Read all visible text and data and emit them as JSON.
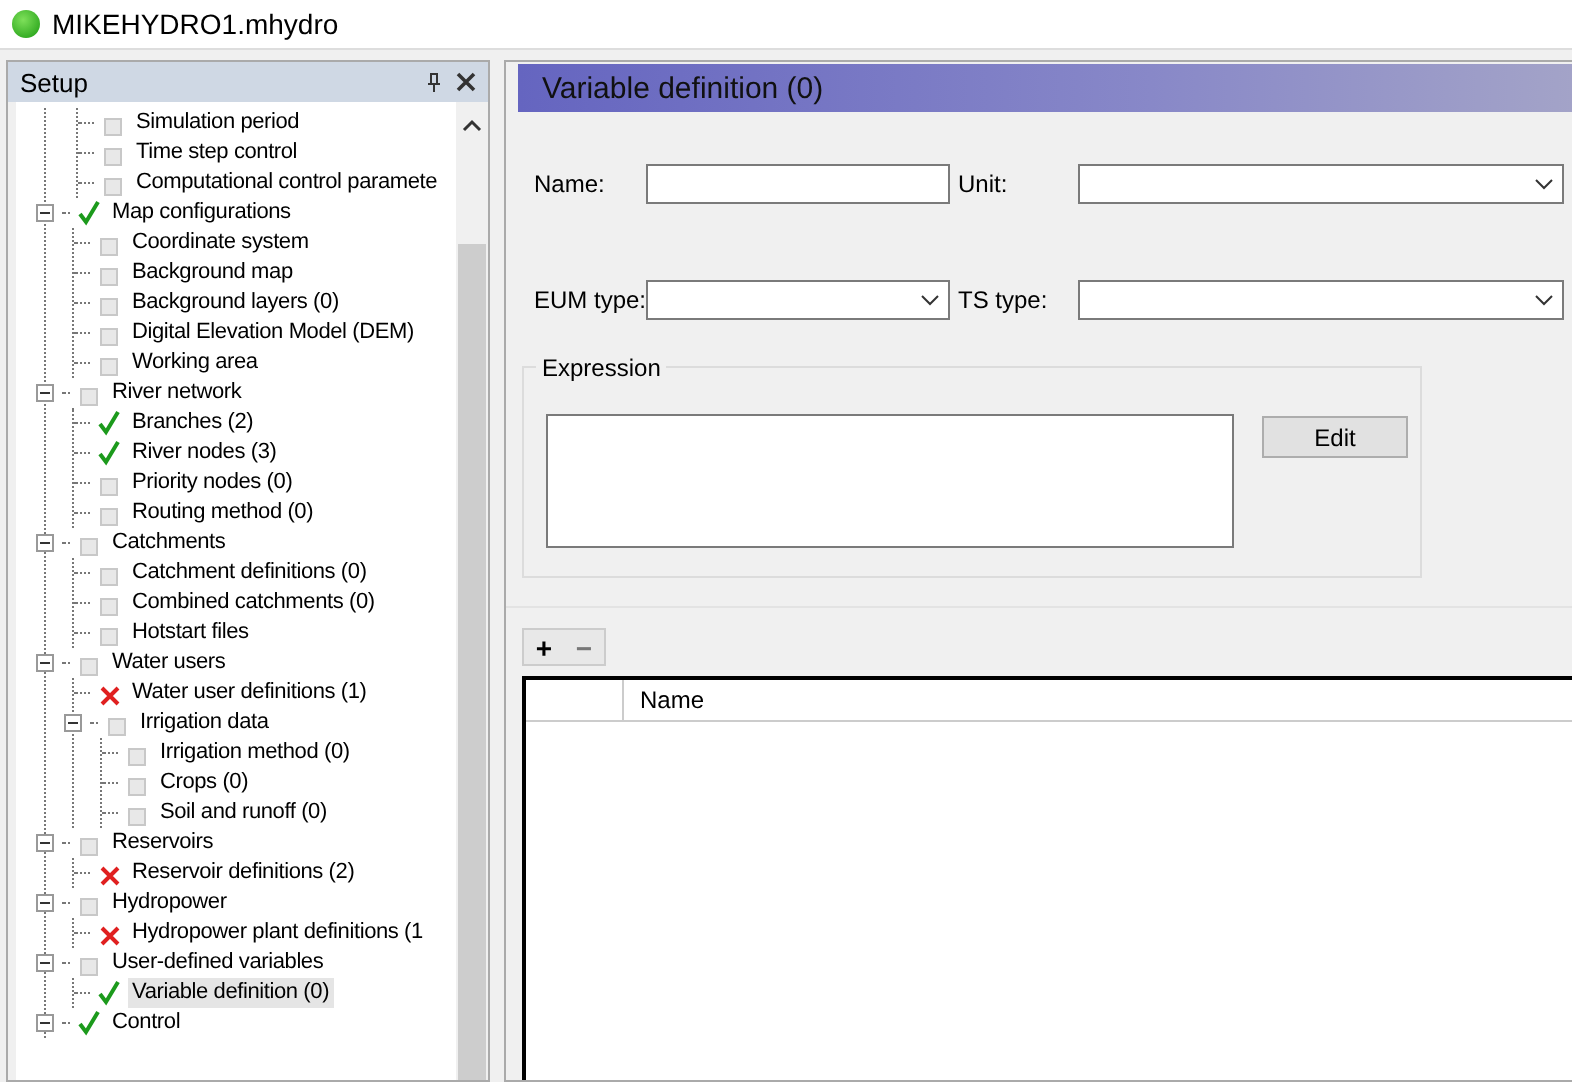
{
  "window": {
    "title": "MIKEHYDRO1.mhydro"
  },
  "setup_panel": {
    "title": "Setup",
    "tree": [
      {
        "children": [
          {
            "label": "Simulation period",
            "checked": false,
            "error": false,
            "selected": false
          },
          {
            "label": "Time step control",
            "checked": false,
            "error": false,
            "selected": false
          },
          {
            "label": "Computational control paramete",
            "checked": false,
            "error": false,
            "selected": false
          }
        ]
      },
      {
        "label": "Map configurations",
        "checked": true,
        "error": false,
        "expanded": true,
        "selected": false,
        "children": [
          {
            "label": "Coordinate system",
            "checked": false,
            "error": false,
            "selected": false
          },
          {
            "label": "Background map",
            "checked": false,
            "error": false,
            "selected": false
          },
          {
            "label": "Background layers (0)",
            "checked": false,
            "error": false,
            "selected": false
          },
          {
            "label": "Digital Elevation Model (DEM)",
            "checked": false,
            "error": false,
            "selected": false
          },
          {
            "label": "Working area",
            "checked": false,
            "error": false,
            "selected": false
          }
        ]
      },
      {
        "label": "River network",
        "checked": false,
        "error": false,
        "expanded": true,
        "selected": false,
        "children": [
          {
            "label": "Branches (2)",
            "checked": true,
            "error": false,
            "selected": false
          },
          {
            "label": "River nodes (3)",
            "checked": true,
            "error": false,
            "selected": false
          },
          {
            "label": "Priority nodes (0)",
            "checked": false,
            "error": false,
            "selected": false
          },
          {
            "label": "Routing method (0)",
            "checked": false,
            "error": false,
            "selected": false
          }
        ]
      },
      {
        "label": "Catchments",
        "checked": false,
        "error": false,
        "expanded": true,
        "selected": false,
        "children": [
          {
            "label": "Catchment definitions (0)",
            "checked": false,
            "error": false,
            "selected": false
          },
          {
            "label": "Combined catchments (0)",
            "checked": false,
            "error": false,
            "selected": false
          },
          {
            "label": "Hotstart files",
            "checked": false,
            "error": false,
            "selected": false
          }
        ]
      },
      {
        "label": "Water users",
        "checked": false,
        "error": false,
        "expanded": true,
        "selected": false,
        "children": [
          {
            "label": "Water user definitions (1)",
            "checked": false,
            "error": true,
            "selected": false
          },
          {
            "label": "Irrigation data",
            "checked": false,
            "error": false,
            "expanded": true,
            "selected": false,
            "children": [
              {
                "label": "Irrigation method (0)",
                "checked": false,
                "error": false,
                "selected": false
              },
              {
                "label": "Crops (0)",
                "checked": false,
                "error": false,
                "selected": false
              },
              {
                "label": "Soil and runoff (0)",
                "checked": false,
                "error": false,
                "selected": false
              }
            ]
          }
        ]
      },
      {
        "label": "Reservoirs",
        "checked": false,
        "error": false,
        "expanded": true,
        "selected": false,
        "children": [
          {
            "label": "Reservoir definitions (2)",
            "checked": false,
            "error": true,
            "selected": false
          }
        ]
      },
      {
        "label": "Hydropower",
        "checked": false,
        "error": false,
        "expanded": true,
        "selected": false,
        "children": [
          {
            "label": "Hydropower plant definitions (1",
            "checked": false,
            "error": true,
            "selected": false
          }
        ]
      },
      {
        "label": "User-defined variables",
        "checked": false,
        "error": false,
        "expanded": true,
        "selected": false,
        "children": [
          {
            "label": "Variable definition (0)",
            "checked": true,
            "error": false,
            "selected": true
          }
        ]
      },
      {
        "label": "Control",
        "checked": true,
        "error": false,
        "expanded": true,
        "selected": false
      }
    ]
  },
  "editor": {
    "title": "Variable definition (0)",
    "fields": [
      {
        "kind": "text",
        "label": "Name:"
      },
      {
        "kind": "dropdown",
        "label": "Unit:"
      },
      {
        "kind": "dropdown",
        "label": "EUM type:"
      },
      {
        "kind": "dropdown",
        "label": "TS type:"
      }
    ],
    "expression": {
      "label": "Expression",
      "button": "Edit"
    },
    "toolbar": [
      {
        "kind": "add",
        "label": "+"
      },
      {
        "kind": "remove",
        "label": "−"
      }
    ],
    "table": {
      "columns": [
        {
          "label": "Name"
        }
      ]
    }
  }
}
